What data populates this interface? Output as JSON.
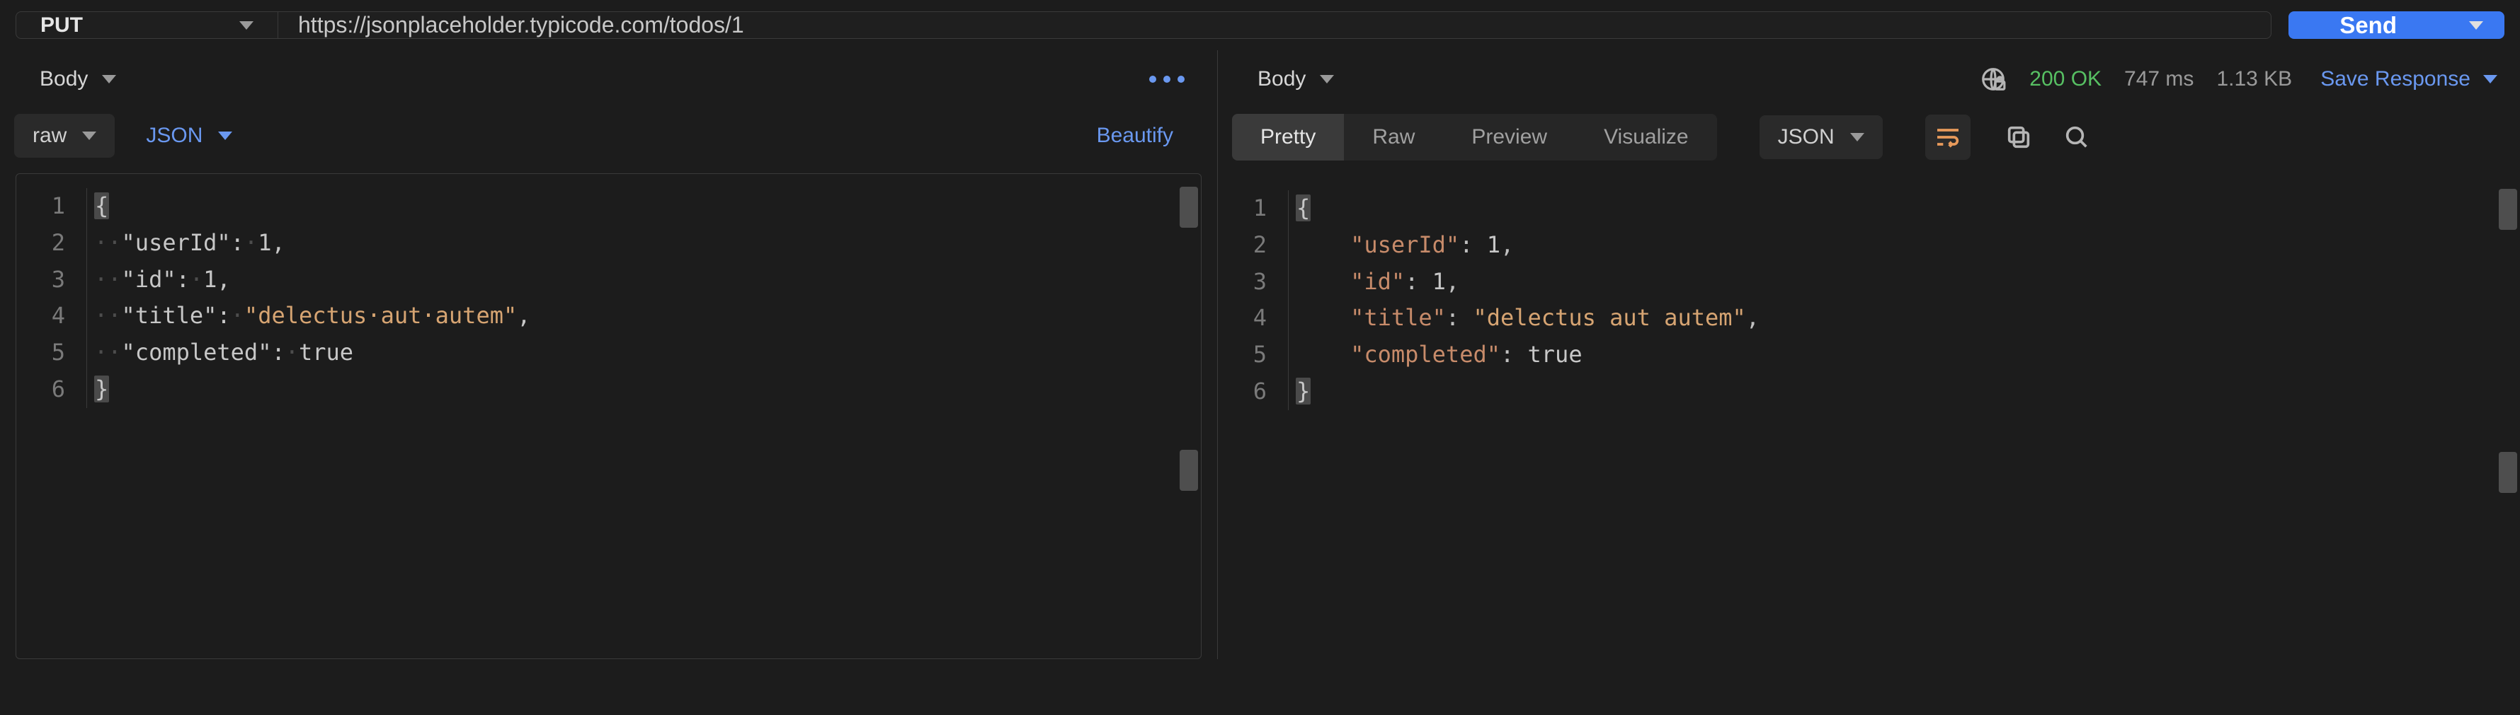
{
  "request": {
    "method": "PUT",
    "url": "https://jsonplaceholder.typicode.com/todos/1",
    "send_label": "Send"
  },
  "left": {
    "tab_label": "Body",
    "body_type": "raw",
    "body_format": "JSON",
    "beautify_label": "Beautify",
    "code_lines": [
      {
        "n": 1,
        "tokens": [
          {
            "t": "brace",
            "v": "{"
          }
        ]
      },
      {
        "n": 2,
        "tokens": [
          {
            "t": "ws",
            "v": "··"
          },
          {
            "t": "key",
            "v": "\"userId\""
          },
          {
            "t": "punct",
            "v": ":"
          },
          {
            "t": "ws",
            "v": "·"
          },
          {
            "t": "number",
            "v": "1"
          },
          {
            "t": "punct",
            "v": ","
          }
        ]
      },
      {
        "n": 3,
        "tokens": [
          {
            "t": "ws",
            "v": "··"
          },
          {
            "t": "key",
            "v": "\"id\""
          },
          {
            "t": "punct",
            "v": ":"
          },
          {
            "t": "ws",
            "v": "·"
          },
          {
            "t": "number",
            "v": "1"
          },
          {
            "t": "punct",
            "v": ","
          }
        ]
      },
      {
        "n": 4,
        "tokens": [
          {
            "t": "ws",
            "v": "··"
          },
          {
            "t": "key",
            "v": "\"title\""
          },
          {
            "t": "punct",
            "v": ":"
          },
          {
            "t": "ws",
            "v": "·"
          },
          {
            "t": "string",
            "v": "\"delectus·aut·autem\""
          },
          {
            "t": "punct",
            "v": ","
          }
        ]
      },
      {
        "n": 5,
        "tokens": [
          {
            "t": "ws",
            "v": "··"
          },
          {
            "t": "key",
            "v": "\"completed\""
          },
          {
            "t": "punct",
            "v": ":"
          },
          {
            "t": "ws",
            "v": "·"
          },
          {
            "t": "bool",
            "v": "true"
          }
        ]
      },
      {
        "n": 6,
        "tokens": [
          {
            "t": "brace",
            "v": "}"
          }
        ]
      }
    ]
  },
  "right": {
    "tab_label": "Body",
    "status_code": "200",
    "status_text": "OK",
    "time": "747 ms",
    "size": "1.13 KB",
    "save_label": "Save Response",
    "views": {
      "pretty": "Pretty",
      "raw": "Raw",
      "preview": "Preview",
      "visualize": "Visualize"
    },
    "format": "JSON",
    "code_lines": [
      {
        "n": 1,
        "tokens": [
          {
            "t": "brace",
            "v": "{"
          }
        ]
      },
      {
        "n": 2,
        "tokens": [
          {
            "t": "indent",
            "v": "    "
          },
          {
            "t": "key",
            "v": "\"userId\""
          },
          {
            "t": "punct",
            "v": ": "
          },
          {
            "t": "number",
            "v": "1"
          },
          {
            "t": "punct",
            "v": ","
          }
        ]
      },
      {
        "n": 3,
        "tokens": [
          {
            "t": "indent",
            "v": "    "
          },
          {
            "t": "key",
            "v": "\"id\""
          },
          {
            "t": "punct",
            "v": ": "
          },
          {
            "t": "number",
            "v": "1"
          },
          {
            "t": "punct",
            "v": ","
          }
        ]
      },
      {
        "n": 4,
        "tokens": [
          {
            "t": "indent",
            "v": "    "
          },
          {
            "t": "key",
            "v": "\"title\""
          },
          {
            "t": "punct",
            "v": ": "
          },
          {
            "t": "string",
            "v": "\"delectus aut autem\""
          },
          {
            "t": "punct",
            "v": ","
          }
        ]
      },
      {
        "n": 5,
        "tokens": [
          {
            "t": "indent",
            "v": "    "
          },
          {
            "t": "key",
            "v": "\"completed\""
          },
          {
            "t": "punct",
            "v": ": "
          },
          {
            "t": "bool",
            "v": "true"
          }
        ]
      },
      {
        "n": 6,
        "tokens": [
          {
            "t": "brace",
            "v": "}"
          }
        ]
      }
    ]
  }
}
